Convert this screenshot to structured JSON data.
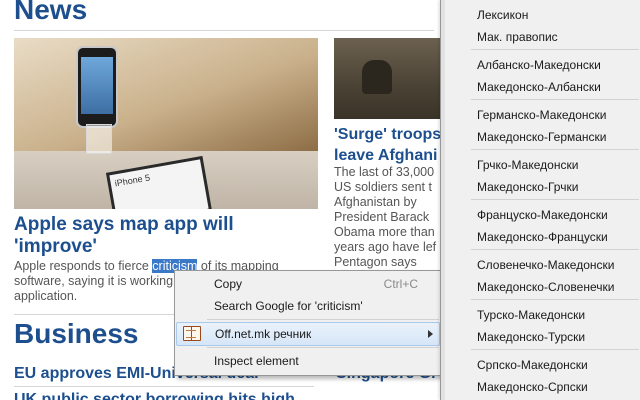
{
  "page": {
    "sections": {
      "news": "News",
      "business": "Business"
    },
    "articles": {
      "main": {
        "photo_caption": "iPhone 5",
        "headline_line1": "Apple says map app will",
        "headline_line2": "'improve'",
        "body_line1_before": "Apple responds to fierce ",
        "body_line1_selected": "criticism",
        "body_line1_after": " of its mapping",
        "body_line2": "software, saying it is working",
        "body_line3": "application."
      },
      "side": {
        "headline_line1": "'Surge' troops",
        "headline_line2": "leave Afghani",
        "body_lines": [
          "The last of 33,000",
          "US soldiers sent t",
          "Afghanistan by",
          "President Barack",
          "Obama more than",
          "years ago have lef",
          "Pentagon says"
        ]
      },
      "business_main": {
        "headline": "EU approves EMI-Universal deal"
      },
      "business_side": {
        "headline": "Singapore Gr"
      },
      "business_second": {
        "headline": "UK public sector borrowing hits high"
      }
    }
  },
  "context_menu": {
    "copy": {
      "label": "Copy",
      "shortcut": "Ctrl+C"
    },
    "search": {
      "label": "Search Google for 'criticism'"
    },
    "dictionary": {
      "label": "Off.net.mk речник",
      "icon": "book-icon"
    },
    "inspect": {
      "label": "Inspect element"
    }
  },
  "submenu": {
    "items": [
      "Лексикон",
      "Мак. правопис",
      "Албанско-Македонски",
      "Македонско-Албански",
      "Германско-Македонски",
      "Македонско-Германски",
      "Грчко-Македонски",
      "Македонско-Грчки",
      "Француско-Македонски",
      "Македонско-Француски",
      "Словенечко-Македонски",
      "Македонско-Словенечки",
      "Турско-Македонски",
      "Македонско-Турски",
      "Српско-Македонски",
      "Македонско-Српски"
    ]
  },
  "colors": {
    "headline": "#1d4f8f",
    "selection": "#3a78c8",
    "menu_background": "#f0f0f0"
  }
}
